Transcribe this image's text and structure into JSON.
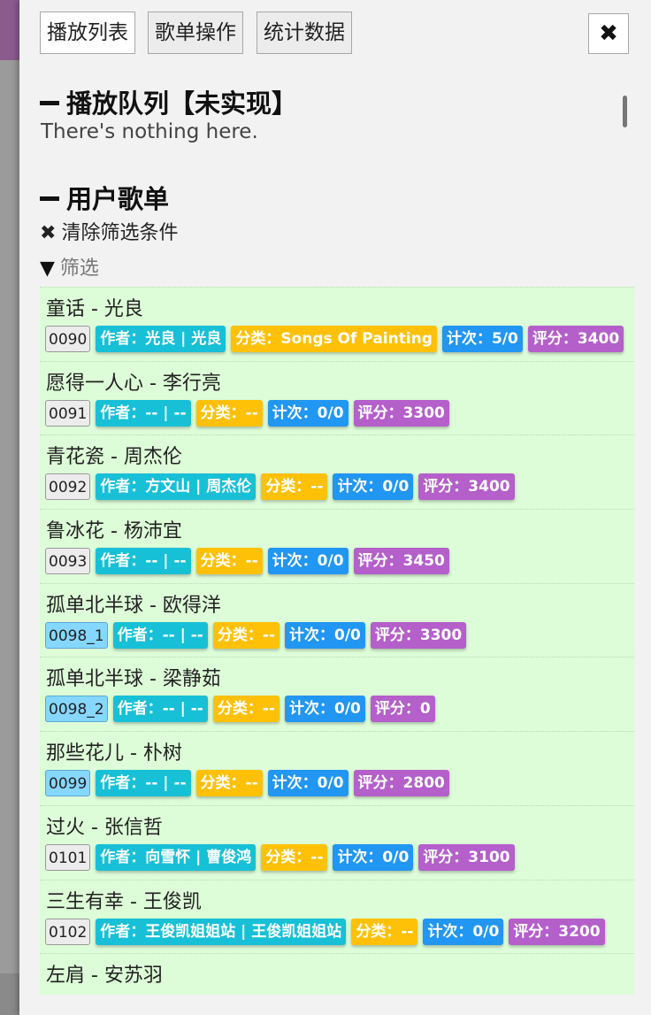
{
  "tabs": [
    "播放列表",
    "歌单操作",
    "统计数据"
  ],
  "close_icon": "✖",
  "queue": {
    "title": "播放队列【未实现】",
    "empty": "There's nothing here."
  },
  "user_list": {
    "title": "用户歌单",
    "clear_filter": "清除筛选条件",
    "filter": "筛选",
    "songs": [
      {
        "title": "童话 - 光良",
        "id": "0090",
        "author": "作者：光良 | 光良",
        "category": "分类：Songs Of Painting",
        "count": "计次：5/0",
        "score": "评分：3400",
        "id_style": "gray"
      },
      {
        "title": "愿得一人心 - 李行亮",
        "id": "0091",
        "author": "作者：-- | --",
        "category": "分类：--",
        "count": "计次：0/0",
        "score": "评分：3300",
        "id_style": "gray"
      },
      {
        "title": "青花瓷 - 周杰伦",
        "id": "0092",
        "author": "作者：方文山 | 周杰伦",
        "category": "分类：--",
        "count": "计次：0/0",
        "score": "评分：3400",
        "id_style": "gray"
      },
      {
        "title": "鲁冰花 - 杨沛宜",
        "id": "0093",
        "author": "作者：-- | --",
        "category": "分类：--",
        "count": "计次：0/0",
        "score": "评分：3450",
        "id_style": "gray"
      },
      {
        "title": "孤单北半球 - 欧得洋",
        "id": "0098_1",
        "author": "作者：-- | --",
        "category": "分类：--",
        "count": "计次：0/0",
        "score": "评分：3300",
        "id_style": "blue"
      },
      {
        "title": "孤单北半球 - 梁静茹",
        "id": "0098_2",
        "author": "作者：-- | --",
        "category": "分类：--",
        "count": "计次：0/0",
        "score": "评分：0",
        "id_style": "blue"
      },
      {
        "title": "那些花儿 - 朴树",
        "id": "0099",
        "author": "作者：-- | --",
        "category": "分类：--",
        "count": "计次：0/0",
        "score": "评分：2800",
        "id_style": "blue"
      },
      {
        "title": "过火 - 张信哲",
        "id": "0101",
        "author": "作者：向雪怀 | 曹俊鸿",
        "category": "分类：--",
        "count": "计次：0/0",
        "score": "评分：3100",
        "id_style": "gray"
      },
      {
        "title": "三生有幸 - 王俊凯",
        "id": "0102",
        "author": "作者：王俊凯姐姐站 | 王俊凯姐姐站",
        "category": "分类：--",
        "count": "计次：0/0",
        "score": "评分：3200",
        "id_style": "gray"
      },
      {
        "title": "左肩 - 安苏羽",
        "id": "",
        "author": "",
        "category": "",
        "count": "",
        "score": "",
        "id_style": "gray"
      }
    ]
  },
  "colors": {
    "author": "#17c0d6",
    "category": "#ffc107",
    "count": "#2196f3",
    "score": "#b45fca",
    "list_bg": "#ddfcd8"
  }
}
